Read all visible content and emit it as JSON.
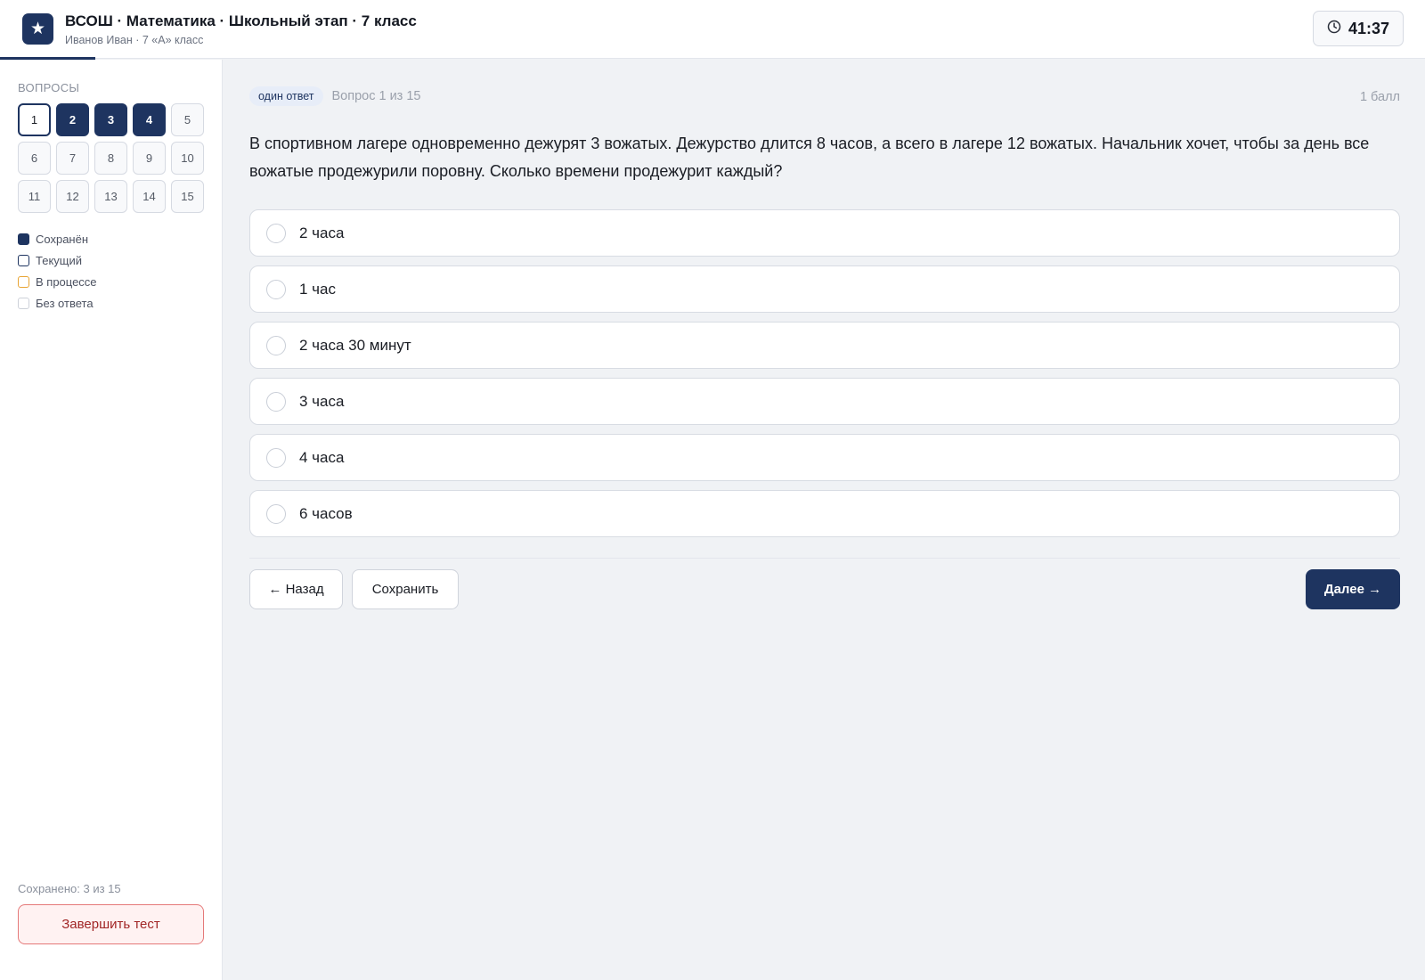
{
  "header": {
    "logo_glyph": "★",
    "title": "ВСОШ · Математика · Школьный этап · 7 класс",
    "subtitle": "Иванов Иван · 7 «А» класс",
    "timer": "41:37",
    "timer_icon": "clock-icon",
    "progress_fraction": 0.0667
  },
  "sidebar": {
    "heading": "ВОПРОСЫ",
    "questions": [
      {
        "label": "1",
        "state": "current"
      },
      {
        "label": "2",
        "state": "saved"
      },
      {
        "label": "3",
        "state": "saved"
      },
      {
        "label": "4",
        "state": "saved"
      },
      {
        "label": "5",
        "state": "empty"
      },
      {
        "label": "6",
        "state": "empty"
      },
      {
        "label": "7",
        "state": "empty"
      },
      {
        "label": "8",
        "state": "empty"
      },
      {
        "label": "9",
        "state": "empty"
      },
      {
        "label": "10",
        "state": "empty"
      },
      {
        "label": "11",
        "state": "empty"
      },
      {
        "label": "12",
        "state": "empty"
      },
      {
        "label": "13",
        "state": "empty"
      },
      {
        "label": "14",
        "state": "empty"
      },
      {
        "label": "15",
        "state": "empty"
      }
    ],
    "legend": [
      {
        "label": "Сохранён",
        "state": "saved"
      },
      {
        "label": "Текущий",
        "state": "current"
      },
      {
        "label": "В процессе",
        "state": "progress"
      },
      {
        "label": "Без ответа",
        "state": "empty"
      }
    ],
    "saved_count": "Сохранено: 3 из 15",
    "finish_label": "Завершить тест"
  },
  "question": {
    "type_badge": "один ответ",
    "number": "Вопрос 1 из 15",
    "points": "1 балл",
    "text": "В спортивном лагере одновременно дежурят 3 вожатых. Дежурство длится 8 часов, а всего в лагере 12 вожатых. Начальник хочет, чтобы за день все вожатые продежурили поровну. Сколько времени продежурит каждый?",
    "options": [
      "2 часа",
      "1 час",
      "2 часа 30 минут",
      "3 часа",
      "4 часа",
      "6 часов"
    ]
  },
  "nav": {
    "back_label": "← Назад",
    "save_label": "Сохранить",
    "next_label": "Далее →"
  },
  "colors": {
    "accent": "#1e3460",
    "in_progress": "#e8a432",
    "danger": "#a12626"
  }
}
